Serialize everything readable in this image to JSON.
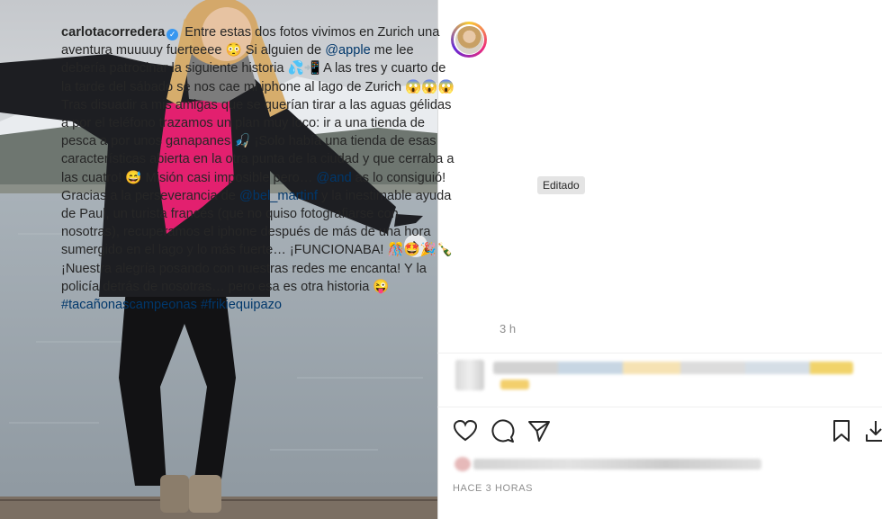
{
  "post": {
    "username": "carlotacorredera",
    "verified_glyph": "✓",
    "caption_parts": [
      {
        "t": "text",
        "v": " Entre estas dos fotos vivimos en Zurich una aventura muuuuy fuerteeee 😳 Si alguien de "
      },
      {
        "t": "link",
        "v": "@apple"
      },
      {
        "t": "text",
        "v": " me lee debería patrocinar la siguiente historia 💦📲 A las tres y cuarto de la tarde del sábado se nos cae mi iphone al lago de Zurich 😱😱😱 Tras disuadir a mis amigas que se querían tirar a las aguas gélidas a por el teléfono trazamos un plan muy loco: ir a una tienda de pesca a por unos ganapanes 🎣 ¡Solo había una tienda de esas características abierta en la otra punta de la ciudad y que cerraba a las cuatro! 😅 Misión casi imposible pero… "
      },
      {
        "t": "link",
        "v": "@and"
      },
      {
        "t": "text",
        "v": "            as lo consiguió! Gracias a la perseverancia de "
      },
      {
        "t": "link",
        "v": "@bel_martinf"
      },
      {
        "t": "text",
        "v": " y la inestimable ayuda de Paul, un turista francés (que no quiso fotografiarse con nosotras), recuperamos el iphone después de más de una hora sumergido en el lago y lo más fuerte… ¡FUNCIONABA! 🎊🤩🎉🍾 ¡Nuestra alegría posando con nuestras redes me encanta! Y la policía detrás de nosotras… pero esa es otra historia 😜 "
      },
      {
        "t": "link",
        "v": "#tacañonascampeonas"
      },
      {
        "t": "text",
        "v": " "
      },
      {
        "t": "link",
        "v": "#frikiequipazo"
      }
    ],
    "tooltip": "Editado",
    "time_ago": "3 h",
    "date_label": "HACE 3 HORAS"
  },
  "icons": {
    "like": "heart-icon",
    "comment": "comment-icon",
    "share": "share-icon",
    "save": "bookmark-icon",
    "download": "download-icon",
    "next": "chevron-right-icon",
    "verified": "verified-badge-icon"
  },
  "colors": {
    "link": "#00376b",
    "verified": "#3897f0",
    "text": "#262626",
    "muted": "#8e8e8e"
  }
}
